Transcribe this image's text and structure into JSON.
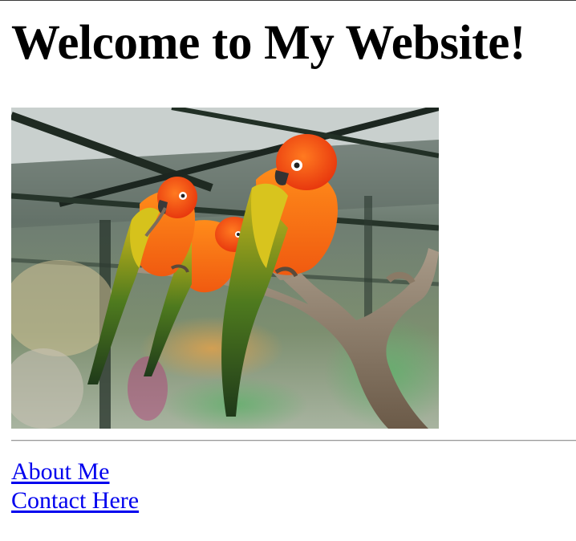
{
  "page": {
    "heading": "Welcome to My Website!"
  },
  "image": {
    "subject": "two sun conure parrots perched on a branch",
    "icon": "parrot-photo"
  },
  "links": [
    {
      "label": "About Me"
    },
    {
      "label": "Contact Here"
    }
  ],
  "colors": {
    "link": "#0000ee",
    "text": "#000000",
    "background": "#ffffff"
  }
}
